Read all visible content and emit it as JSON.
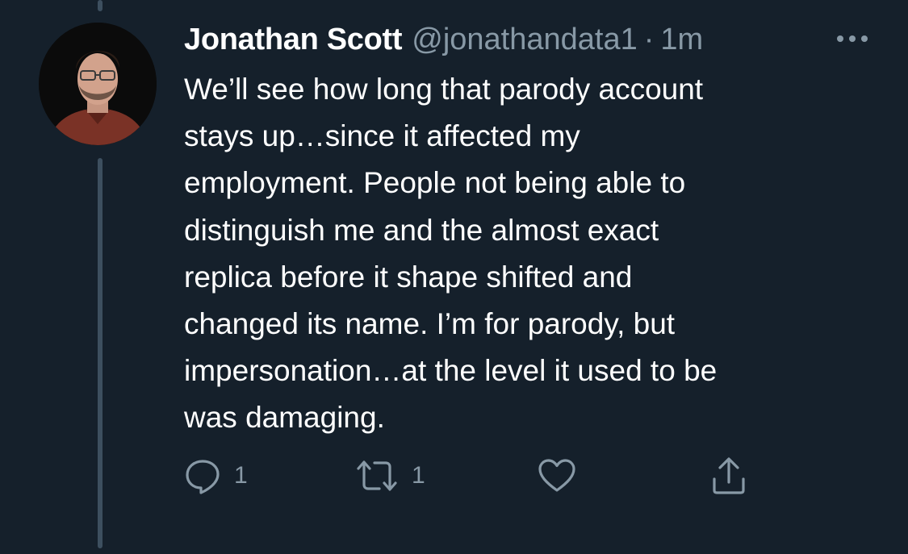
{
  "tweet": {
    "display_name": "Jonathan Scott",
    "handle": "@jonathandata1",
    "separator": "·",
    "time": "1m",
    "body_lines": [
      "We’ll see how long that parody account",
      "stays up…since it affected my",
      "employment. People not being able to",
      "distinguish me and the almost exact",
      "replica before it shape shifted and",
      "changed its name. I’m for parody, but",
      "impersonation…at the level it used to be",
      "was damaging."
    ]
  },
  "actions": {
    "reply_count": "1",
    "retweet_count": "1",
    "like_count": "",
    "share_count": ""
  },
  "icons": {
    "more": "more-horizontal-icon",
    "reply": "speech-bubble-icon",
    "retweet": "retweet-arrows-icon",
    "like": "heart-outline-icon",
    "share": "share-upload-icon"
  },
  "colors": {
    "background": "#15202b",
    "text_primary": "#ffffff",
    "text_secondary": "#8899a6",
    "thread_line": "#3d4f5f"
  }
}
